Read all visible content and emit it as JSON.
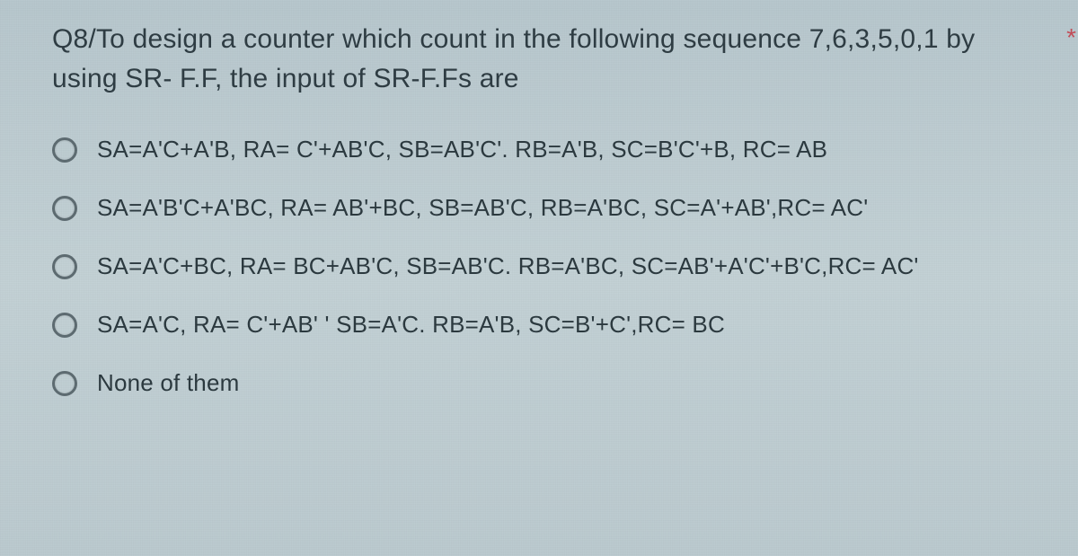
{
  "question": {
    "text": "Q8/To design a counter which count in the following sequence 7,6,3,5,0,1 by using SR- F.F, the input of SR-F.Fs are",
    "required_mark": "*"
  },
  "options": [
    {
      "label": "SA=A'C+A'B, RA= C'+AB'C, SB=AB'C'. RB=A'B, SC=B'C'+B, RC= AB"
    },
    {
      "label": "SA=A'B'C+A'BC, RA= AB'+BC, SB=AB'C, RB=A'BC, SC=A'+AB',RC= AC'"
    },
    {
      "label": "SA=A'C+BC, RA= BC+AB'C, SB=AB'C. RB=A'BC, SC=AB'+A'C'+B'C,RC= AC'"
    },
    {
      "label": "SA=A'C, RA= C'+AB' ' SB=A'C. RB=A'B, SC=B'+C',RC= BC"
    },
    {
      "label": "None of them"
    }
  ]
}
